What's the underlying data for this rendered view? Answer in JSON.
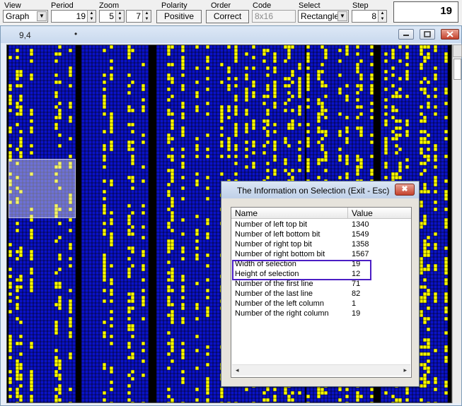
{
  "toolbar": {
    "view": {
      "label": "View",
      "value": "Graph"
    },
    "period": {
      "label": "Period",
      "value": "19"
    },
    "zoom": {
      "label": "Zoom",
      "value_a": "5",
      "value_b": "7"
    },
    "polarity": {
      "label": "Polarity",
      "value": "Positive"
    },
    "order": {
      "label": "Order",
      "value": "Correct"
    },
    "code": {
      "label": "Code",
      "value": "8x16"
    },
    "select": {
      "label": "Select",
      "value": "Rectangle"
    },
    "step": {
      "label": "Step",
      "value": "8"
    },
    "big_value": "19"
  },
  "window": {
    "coord": "9,4",
    "dot": "•"
  },
  "colors": {
    "grid_blue": "#0a12c8",
    "bit_yellow": "#ffff00",
    "gridline": "#000000"
  },
  "dialog": {
    "title": "The Information on Selection (Exit - Esc)",
    "close": "✖",
    "headers": {
      "name": "Name",
      "value": "Value"
    },
    "rows": [
      {
        "name": "Number of left top bit",
        "value": "1340"
      },
      {
        "name": "Number of left bottom bit",
        "value": "1549"
      },
      {
        "name": "Number of right top bit",
        "value": "1358"
      },
      {
        "name": "Number of right bottom bit",
        "value": "1567"
      },
      {
        "name": "Width of selection",
        "value": "19"
      },
      {
        "name": "Height of selection",
        "value": "12"
      },
      {
        "name": "Number of the first line",
        "value": "71"
      },
      {
        "name": "Number of the last line",
        "value": "82"
      },
      {
        "name": "Number of the left column",
        "value": "1"
      },
      {
        "name": "Number of the right column",
        "value": "19"
      }
    ],
    "hscroll": {
      "left": "◂",
      "right": "▸"
    }
  }
}
